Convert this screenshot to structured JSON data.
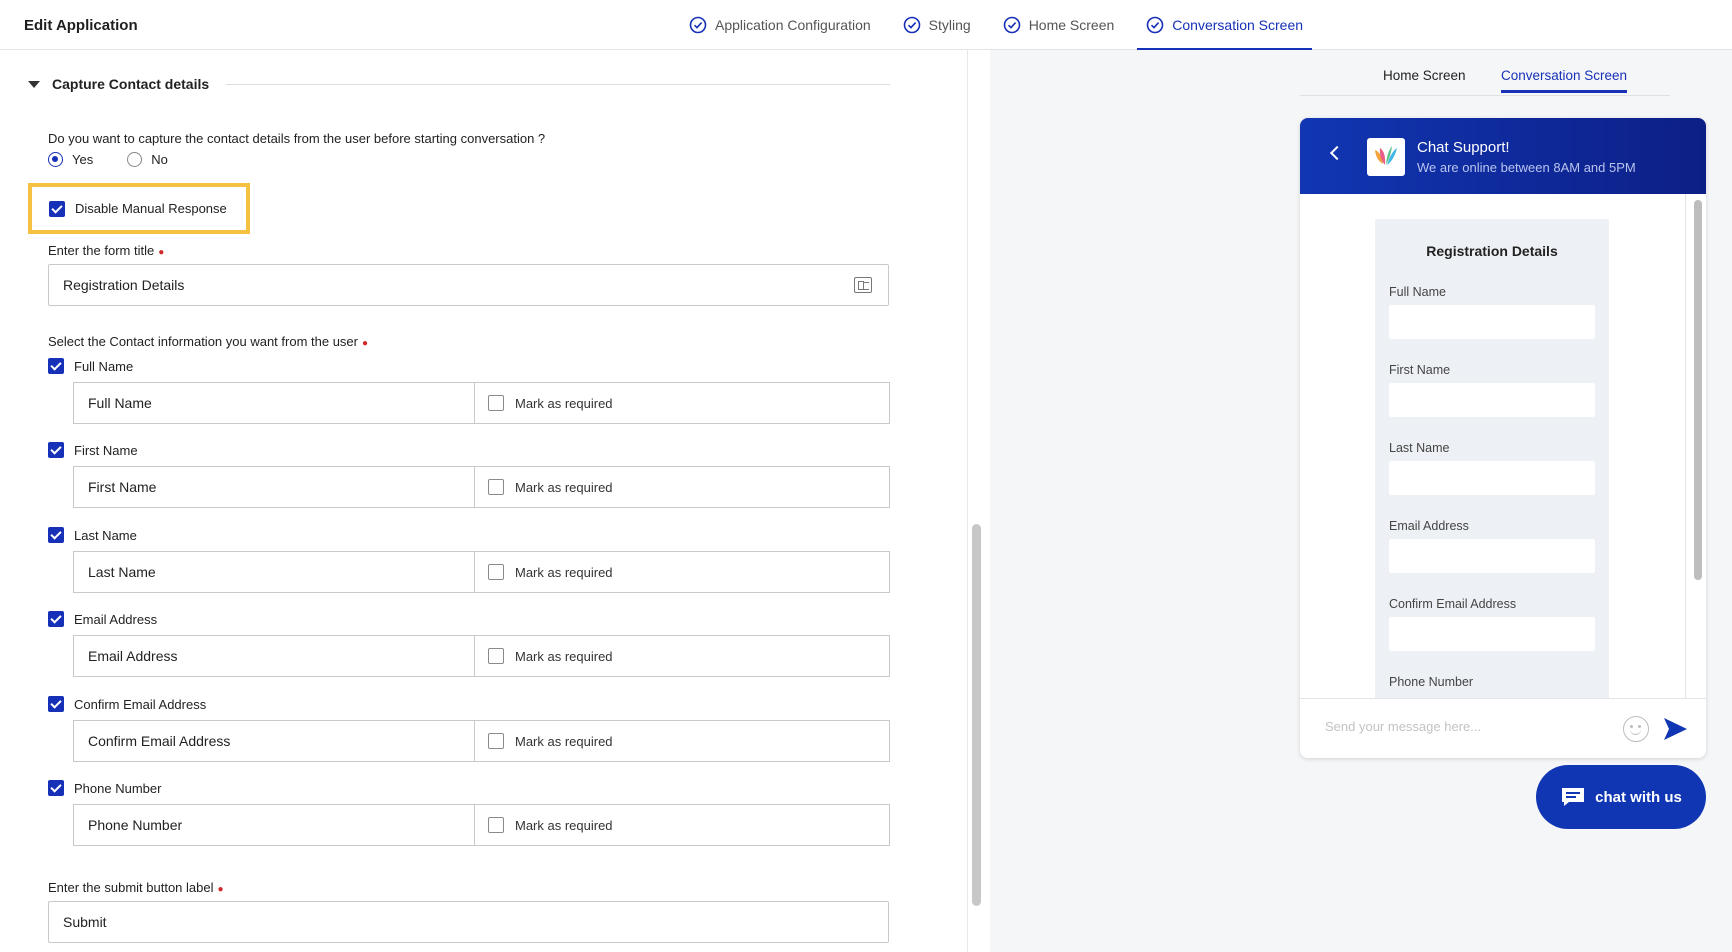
{
  "app_title": "Edit Application",
  "steps": [
    {
      "label": "Application Configuration",
      "active": false
    },
    {
      "label": "Styling",
      "active": false
    },
    {
      "label": "Home Screen",
      "active": false
    },
    {
      "label": "Conversation Screen",
      "active": true
    }
  ],
  "section": {
    "title": "Capture Contact details"
  },
  "capture_question": "Do you want to capture the contact details from the user before starting conversation ?",
  "radio": {
    "yes": "Yes",
    "no": "No",
    "selected": "Yes"
  },
  "disable_manual": {
    "label": "Disable Manual Response",
    "checked": true
  },
  "form_title": {
    "label": "Enter the form title",
    "value": "Registration Details"
  },
  "contact_info_label": "Select the Contact information you want from the user",
  "mark_required_label": "Mark as required",
  "fields": [
    {
      "label": "Full Name",
      "value": "Full Name",
      "checked": true,
      "required": false
    },
    {
      "label": "First Name",
      "value": "First Name",
      "checked": true,
      "required": false
    },
    {
      "label": "Last Name",
      "value": "Last Name",
      "checked": true,
      "required": false
    },
    {
      "label": "Email Address",
      "value": "Email Address",
      "checked": true,
      "required": false
    },
    {
      "label": "Confirm Email Address",
      "value": "Confirm Email Address",
      "checked": true,
      "required": false
    },
    {
      "label": "Phone Number",
      "value": "Phone Number",
      "checked": true,
      "required": false
    }
  ],
  "submit": {
    "label": "Enter the submit button label",
    "value": "Submit"
  },
  "preview": {
    "tabs": [
      {
        "label": "Home Screen",
        "active": false
      },
      {
        "label": "Conversation Screen",
        "active": true
      }
    ],
    "header_title": "Chat Support!",
    "header_subtitle": "We are online between 8AM and 5PM",
    "card_title": "Registration Details",
    "card_fields": [
      "Full Name",
      "First Name",
      "Last Name",
      "Email Address",
      "Confirm Email Address",
      "Phone Number"
    ],
    "message_placeholder": "Send your message here...",
    "chat_button": "chat with us"
  },
  "colors": {
    "accent": "#1730b8",
    "highlight": "#f4c141",
    "header_start": "#1136b3",
    "header_end": "#0d1f86"
  }
}
